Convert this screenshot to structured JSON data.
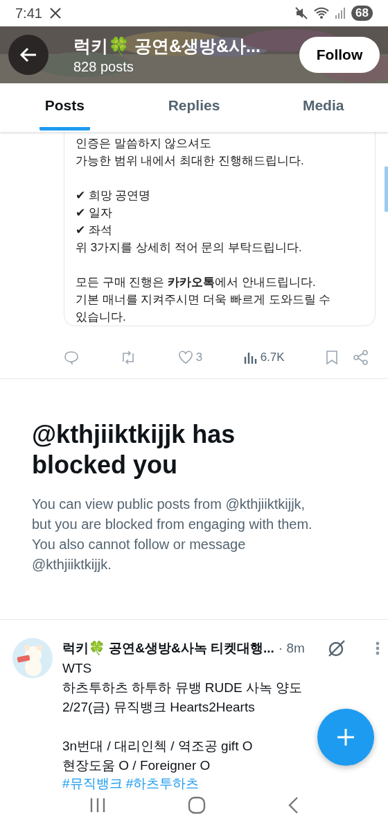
{
  "status_bar": {
    "time": "7:41",
    "battery": "68"
  },
  "header": {
    "title": "럭키🍀 공연&생방&사...",
    "post_count": "828 posts",
    "follow_button": "Follow"
  },
  "tabs": [
    {
      "label": "Posts",
      "selected": true
    },
    {
      "label": "Replies",
      "selected": false
    },
    {
      "label": "Media",
      "selected": false
    }
  ],
  "quoted_post": {
    "paragraphs": [
      "인증은 말씀하지 않으셔도\n가능한 범위 내에서 최대한 진행해드립니다.",
      "✔ 희망 공연명\n✔ 일자\n✔ 좌석\n위 3가지를 상세히 적어 문의 부탁드립니다.",
      "모든 구매 진행은 **카카오톡**에서 안내드립니다.\n기본 매너를 지켜주시면 더욱 빠르게 도와드릴 수\n있습니다."
    ]
  },
  "actions": {
    "likes": "3",
    "views": "6.7K"
  },
  "blocked_notice": {
    "title": "@kthjiiktkijjk has blocked you",
    "body": "You can view public posts from @kthjiiktkijjk, but you are blocked from engaging with them. You also cannot follow or message @kthjiiktkijjk."
  },
  "post": {
    "author": "럭키🍀 공연&생방&사녹 티켓대행...",
    "time": "· 8m",
    "text": "WTS\n하츠투하츠 하투하 뮤뱅 RUDE 사녹 양도\n2/27(금) 뮤직뱅크 Hearts2Hearts\n\n3n번대 / 대리인첵 / 역조공 gift O\n현장도움 O / Foreigner O",
    "hashtags": "#뮤직뱅크 #하츠투하츠"
  }
}
